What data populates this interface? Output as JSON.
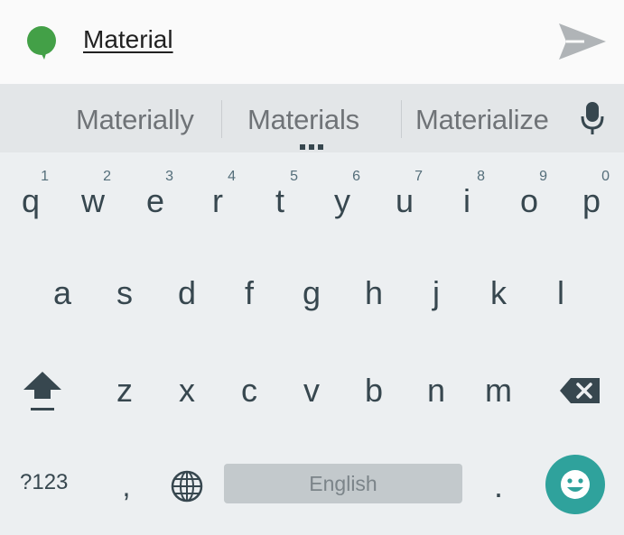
{
  "compose": {
    "text": "Material",
    "avatar_color": "#43a047",
    "icons": {
      "avatar": "speech-bubble-avatar-icon",
      "send": "send-icon"
    }
  },
  "suggestions": {
    "items": [
      "Materially",
      "Materials",
      "Materialize"
    ],
    "more_icon": "ellipsis-icon",
    "mic_icon": "microphone-icon"
  },
  "keyboard": {
    "row1": [
      {
        "key": "q",
        "hint": "1"
      },
      {
        "key": "w",
        "hint": "2"
      },
      {
        "key": "e",
        "hint": "3"
      },
      {
        "key": "r",
        "hint": "4"
      },
      {
        "key": "t",
        "hint": "5"
      },
      {
        "key": "y",
        "hint": "6"
      },
      {
        "key": "u",
        "hint": "7"
      },
      {
        "key": "i",
        "hint": "8"
      },
      {
        "key": "o",
        "hint": "9"
      },
      {
        "key": "p",
        "hint": "0"
      }
    ],
    "row2": [
      "a",
      "s",
      "d",
      "f",
      "g",
      "h",
      "j",
      "k",
      "l"
    ],
    "row3": [
      "z",
      "x",
      "c",
      "v",
      "b",
      "n",
      "m"
    ],
    "symbols_label": "?123",
    "comma": ",",
    "period": ".",
    "space_label": "English",
    "icons": {
      "shift": "shift-icon",
      "backspace": "backspace-icon",
      "language": "globe-icon",
      "emoji": "emoji-icon"
    },
    "accent_color": "#2fa29c"
  }
}
